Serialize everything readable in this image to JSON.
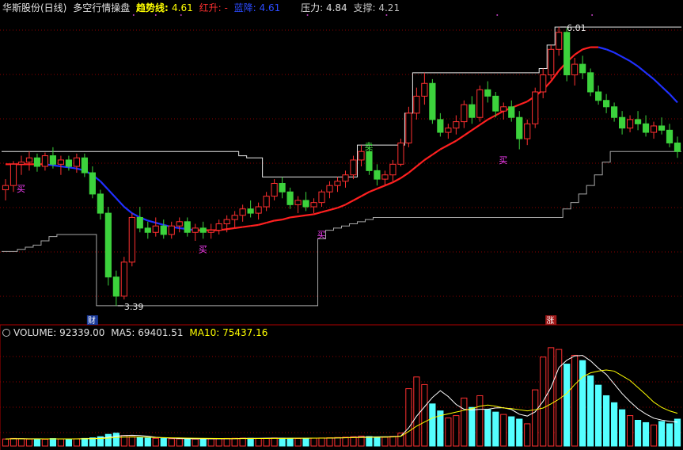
{
  "header": {
    "stock": "华斯股份(日线)",
    "indicator": "多空行情操盘",
    "trend_label": "趋势线:",
    "trend_value": "4.61",
    "red_label": "红升:",
    "red_value": "-",
    "blue_label": "蓝降:",
    "blue_value": "4.61",
    "pressure_label": "压力:",
    "pressure_value": "4.84",
    "support_label": "支撑:",
    "support_value": "4.21"
  },
  "volume_header": {
    "label": "VOLUME:",
    "value": "92339.00",
    "ma5_label": "MA5:",
    "ma5_value": "69401.51",
    "ma10_label": "MA10:",
    "ma10_value": "75437.16"
  },
  "annotations": {
    "high_label": "6.01",
    "low_label": "3.39",
    "buy": "买",
    "sell": "卖",
    "cai": "财",
    "zhang": "涨"
  },
  "colors": {
    "up": "#ff3030",
    "down": "#54ffff",
    "down_candle": "#3cd23c",
    "trend_up": "#ff2020",
    "trend_down": "#2030ff",
    "grid": "#8b0000",
    "ma5": "#ffffff",
    "ma10": "#ffff00"
  },
  "chart_data": {
    "type": "candlestick",
    "price_range": [
      3.3,
      6.1
    ],
    "candles": [
      [
        4.48,
        4.58,
        4.38,
        4.52
      ],
      [
        4.52,
        4.75,
        4.46,
        4.72
      ],
      [
        4.72,
        4.8,
        4.62,
        4.74
      ],
      [
        4.74,
        4.84,
        4.66,
        4.78
      ],
      [
        4.78,
        4.82,
        4.65,
        4.7
      ],
      [
        4.7,
        4.83,
        4.66,
        4.8
      ],
      [
        4.8,
        4.88,
        4.68,
        4.72
      ],
      [
        4.72,
        4.8,
        4.62,
        4.76
      ],
      [
        4.76,
        4.8,
        4.66,
        4.7
      ],
      [
        4.7,
        4.82,
        4.64,
        4.78
      ],
      [
        4.78,
        4.82,
        4.6,
        4.64
      ],
      [
        4.64,
        4.7,
        4.4,
        4.44
      ],
      [
        4.44,
        4.48,
        4.2,
        4.26
      ],
      [
        4.26,
        4.32,
        3.58,
        3.66
      ],
      [
        3.66,
        3.72,
        3.39,
        3.48
      ],
      [
        3.48,
        3.85,
        3.45,
        3.8
      ],
      [
        3.8,
        4.26,
        3.76,
        4.22
      ],
      [
        4.22,
        4.32,
        4.08,
        4.12
      ],
      [
        4.12,
        4.18,
        4.02,
        4.08
      ],
      [
        4.08,
        4.22,
        4.04,
        4.14
      ],
      [
        4.14,
        4.2,
        4.02,
        4.06
      ],
      [
        4.06,
        4.18,
        4.02,
        4.14
      ],
      [
        4.14,
        4.22,
        4.08,
        4.18
      ],
      [
        4.18,
        4.22,
        4.04,
        4.08
      ],
      [
        4.08,
        4.16,
        4.0,
        4.12
      ],
      [
        4.12,
        4.18,
        4.02,
        4.08
      ],
      [
        4.08,
        4.16,
        4.02,
        4.1
      ],
      [
        4.1,
        4.2,
        4.06,
        4.16
      ],
      [
        4.16,
        4.24,
        4.08,
        4.2
      ],
      [
        4.2,
        4.28,
        4.12,
        4.24
      ],
      [
        4.24,
        4.34,
        4.18,
        4.3
      ],
      [
        4.3,
        4.38,
        4.22,
        4.26
      ],
      [
        4.26,
        4.36,
        4.2,
        4.32
      ],
      [
        4.32,
        4.46,
        4.28,
        4.42
      ],
      [
        4.42,
        4.58,
        4.38,
        4.54
      ],
      [
        4.54,
        4.6,
        4.4,
        4.46
      ],
      [
        4.46,
        4.5,
        4.3,
        4.34
      ],
      [
        4.34,
        4.42,
        4.26,
        4.38
      ],
      [
        4.38,
        4.46,
        4.28,
        4.32
      ],
      [
        4.32,
        4.4,
        4.26,
        4.36
      ],
      [
        4.36,
        4.48,
        4.32,
        4.46
      ],
      [
        4.46,
        4.56,
        4.4,
        4.52
      ],
      [
        4.52,
        4.6,
        4.46,
        4.56
      ],
      [
        4.56,
        4.66,
        4.5,
        4.62
      ],
      [
        4.62,
        4.8,
        4.58,
        4.76
      ],
      [
        4.76,
        4.9,
        4.7,
        4.84
      ],
      [
        4.84,
        4.88,
        4.62,
        4.66
      ],
      [
        4.66,
        4.72,
        4.52,
        4.58
      ],
      [
        4.58,
        4.66,
        4.52,
        4.62
      ],
      [
        4.62,
        4.76,
        4.56,
        4.72
      ],
      [
        4.72,
        4.96,
        4.7,
        4.92
      ],
      [
        4.92,
        5.26,
        4.88,
        5.2
      ],
      [
        5.2,
        5.44,
        5.14,
        5.36
      ],
      [
        5.36,
        5.58,
        5.28,
        5.48
      ],
      [
        5.48,
        5.52,
        5.1,
        5.14
      ],
      [
        5.14,
        5.2,
        4.98,
        5.02
      ],
      [
        5.02,
        5.1,
        4.96,
        5.06
      ],
      [
        5.06,
        5.18,
        5.0,
        5.12
      ],
      [
        5.12,
        5.32,
        5.06,
        5.28
      ],
      [
        5.28,
        5.36,
        5.1,
        5.16
      ],
      [
        5.16,
        5.46,
        5.12,
        5.42
      ],
      [
        5.42,
        5.5,
        5.3,
        5.36
      ],
      [
        5.36,
        5.4,
        5.16,
        5.22
      ],
      [
        5.22,
        5.3,
        5.14,
        5.26
      ],
      [
        5.26,
        5.32,
        5.12,
        5.16
      ],
      [
        5.16,
        5.22,
        4.86,
        4.96
      ],
      [
        4.96,
        5.14,
        4.9,
        5.1
      ],
      [
        5.1,
        5.44,
        5.06,
        5.4
      ],
      [
        5.4,
        5.62,
        5.34,
        5.56
      ],
      [
        5.56,
        5.84,
        5.52,
        5.8
      ],
      [
        5.8,
        6.01,
        5.74,
        5.96
      ],
      [
        5.96,
        6.0,
        5.5,
        5.56
      ],
      [
        5.56,
        5.72,
        5.46,
        5.66
      ],
      [
        5.66,
        5.74,
        5.52,
        5.58
      ],
      [
        5.58,
        5.62,
        5.36,
        5.4
      ],
      [
        5.4,
        5.46,
        5.28,
        5.32
      ],
      [
        5.32,
        5.38,
        5.2,
        5.26
      ],
      [
        5.26,
        5.3,
        5.12,
        5.16
      ],
      [
        5.16,
        5.22,
        5.0,
        5.06
      ],
      [
        5.06,
        5.18,
        5.02,
        5.14
      ],
      [
        5.14,
        5.22,
        5.04,
        5.1
      ],
      [
        5.1,
        5.18,
        4.98,
        5.02
      ],
      [
        5.02,
        5.12,
        4.96,
        5.08
      ],
      [
        5.08,
        5.16,
        5.0,
        5.04
      ],
      [
        5.04,
        5.1,
        4.88,
        4.92
      ],
      [
        4.92,
        4.98,
        4.78,
        4.84
      ]
    ],
    "volume_range": [
      0,
      180000
    ],
    "volumes": [
      12000,
      13000,
      12500,
      11800,
      12200,
      11500,
      12800,
      12000,
      11900,
      12300,
      13000,
      14000,
      16000,
      20000,
      22000,
      18000,
      16000,
      14500,
      13800,
      13200,
      12800,
      12500,
      12200,
      12000,
      11800,
      12100,
      12300,
      12600,
      13000,
      13200,
      13500,
      13100,
      12900,
      13300,
      13800,
      13500,
      13000,
      12800,
      13100,
      13400,
      13800,
      14200,
      14600,
      15200,
      16000,
      17000,
      16200,
      15500,
      15000,
      16500,
      22000,
      98000,
      118000,
      105000,
      72000,
      60000,
      48000,
      52000,
      82000,
      66000,
      86000,
      62000,
      58000,
      54000,
      50000,
      46000,
      38000,
      96000,
      152000,
      168000,
      165000,
      140000,
      155000,
      146000,
      120000,
      104000,
      86000,
      74000,
      62000,
      52000,
      44000,
      40000,
      36000,
      42000,
      38000,
      46000
    ],
    "ma5": [
      12000,
      12500,
      12500,
      12300,
      12300,
      12200,
      12200,
      12100,
      12100,
      12100,
      12500,
      12900,
      13400,
      15000,
      17000,
      18000,
      18400,
      17900,
      16800,
      15100,
      14100,
      13500,
      12900,
      12600,
      12300,
      12300,
      12300,
      12300,
      12400,
      12600,
      13100,
      13200,
      13200,
      13400,
      13500,
      13400,
      13300,
      13300,
      13400,
      13500,
      13500,
      13600,
      13800,
      14200,
      14800,
      15300,
      15600,
      15800,
      15900,
      16000,
      17000,
      31000,
      51000,
      67000,
      83000,
      94600,
      84600,
      71000,
      62800,
      61600,
      62800,
      62800,
      65200,
      65400,
      62400,
      54400,
      51200,
      58400,
      76400,
      100000,
      134000,
      146600,
      154000,
      154800,
      145600,
      133000,
      122400,
      106000,
      89600,
      75800,
      63600,
      54800,
      47600,
      44400,
      42200,
      40800
    ],
    "ma10": [
      12000,
      12400,
      12400,
      12200,
      12200,
      12100,
      12200,
      12100,
      12100,
      12100,
      12300,
      12500,
      12800,
      13500,
      14500,
      15200,
      15500,
      15400,
      15100,
      14600,
      14300,
      14100,
      13800,
      13500,
      13300,
      13200,
      13000,
      12800,
      12700,
      12600,
      12700,
      12700,
      12800,
      12900,
      13000,
      13100,
      13200,
      13300,
      13400,
      13500,
      13600,
      13700,
      13900,
      14100,
      14400,
      14600,
      14900,
      15100,
      15300,
      15500,
      16500,
      25000,
      34000,
      41000,
      48000,
      52000,
      55000,
      58000,
      61000,
      64000,
      68000,
      70000,
      68000,
      65000,
      64000,
      62000,
      60000,
      62000,
      65000,
      72000,
      80000,
      90000,
      105000,
      118000,
      125000,
      128000,
      130000,
      128000,
      120000,
      112000,
      100000,
      88000,
      75000,
      66000,
      60000,
      56000
    ],
    "trend": [
      4.72,
      4.72,
      4.72,
      4.72,
      4.72,
      4.72,
      4.71,
      4.7,
      4.69,
      4.68,
      4.66,
      4.62,
      4.56,
      4.48,
      4.4,
      4.32,
      4.26,
      4.22,
      4.19,
      4.17,
      4.15,
      4.13,
      4.12,
      4.11,
      4.1,
      4.1,
      4.1,
      4.1,
      4.11,
      4.12,
      4.13,
      4.14,
      4.15,
      4.17,
      4.19,
      4.2,
      4.22,
      4.23,
      4.24,
      4.25,
      4.27,
      4.29,
      4.31,
      4.34,
      4.38,
      4.42,
      4.46,
      4.49,
      4.52,
      4.55,
      4.59,
      4.64,
      4.7,
      4.76,
      4.81,
      4.86,
      4.9,
      4.94,
      4.99,
      5.04,
      5.09,
      5.14,
      5.18,
      5.22,
      5.25,
      5.28,
      5.31,
      5.36,
      5.42,
      5.5,
      5.6,
      5.68,
      5.75,
      5.8,
      5.82,
      5.82,
      5.8,
      5.77,
      5.73,
      5.69,
      5.64,
      5.58,
      5.52,
      5.45,
      5.38,
      5.3
    ],
    "resistance": [
      4.84,
      4.84,
      4.84,
      4.84,
      4.84,
      4.84,
      4.84,
      4.84,
      4.84,
      4.84,
      4.84,
      4.84,
      4.84,
      4.84,
      4.84,
      4.84,
      4.84,
      4.84,
      4.84,
      4.84,
      4.84,
      4.84,
      4.84,
      4.84,
      4.84,
      4.84,
      4.84,
      4.84,
      4.84,
      4.84,
      4.8,
      4.78,
      4.78,
      4.6,
      4.6,
      4.6,
      4.6,
      4.6,
      4.6,
      4.6,
      4.6,
      4.6,
      4.6,
      4.6,
      4.6,
      4.9,
      4.9,
      4.9,
      4.9,
      4.9,
      4.9,
      5.2,
      5.58,
      5.58,
      5.58,
      5.58,
      5.58,
      5.58,
      5.58,
      5.58,
      5.58,
      5.58,
      5.58,
      5.58,
      5.58,
      5.58,
      5.58,
      5.58,
      5.62,
      5.84,
      6.01,
      6.01,
      6.01,
      6.01,
      6.01,
      6.01,
      6.01,
      6.01,
      6.01,
      6.01,
      6.01,
      6.01,
      6.01,
      6.01,
      6.01,
      6.01
    ],
    "support": [
      3.9,
      3.9,
      3.92,
      3.94,
      3.96,
      4.0,
      4.04,
      4.06,
      4.06,
      4.06,
      4.06,
      4.06,
      3.39,
      3.39,
      3.39,
      3.39,
      3.39,
      3.39,
      3.39,
      3.39,
      3.39,
      3.39,
      3.39,
      3.39,
      3.39,
      3.39,
      3.39,
      3.39,
      3.39,
      3.39,
      3.39,
      3.39,
      3.39,
      3.39,
      3.39,
      3.39,
      3.39,
      3.39,
      3.39,
      3.39,
      4.02,
      4.1,
      4.12,
      4.14,
      4.16,
      4.18,
      4.2,
      4.22,
      4.22,
      4.22,
      4.22,
      4.22,
      4.22,
      4.22,
      4.22,
      4.22,
      4.22,
      4.22,
      4.22,
      4.22,
      4.22,
      4.22,
      4.22,
      4.22,
      4.22,
      4.22,
      4.22,
      4.22,
      4.22,
      4.22,
      4.22,
      4.3,
      4.36,
      4.44,
      4.52,
      4.62,
      4.74,
      4.84,
      4.84,
      4.84,
      4.84,
      4.84,
      4.84,
      4.84,
      4.84,
      4.84
    ]
  }
}
